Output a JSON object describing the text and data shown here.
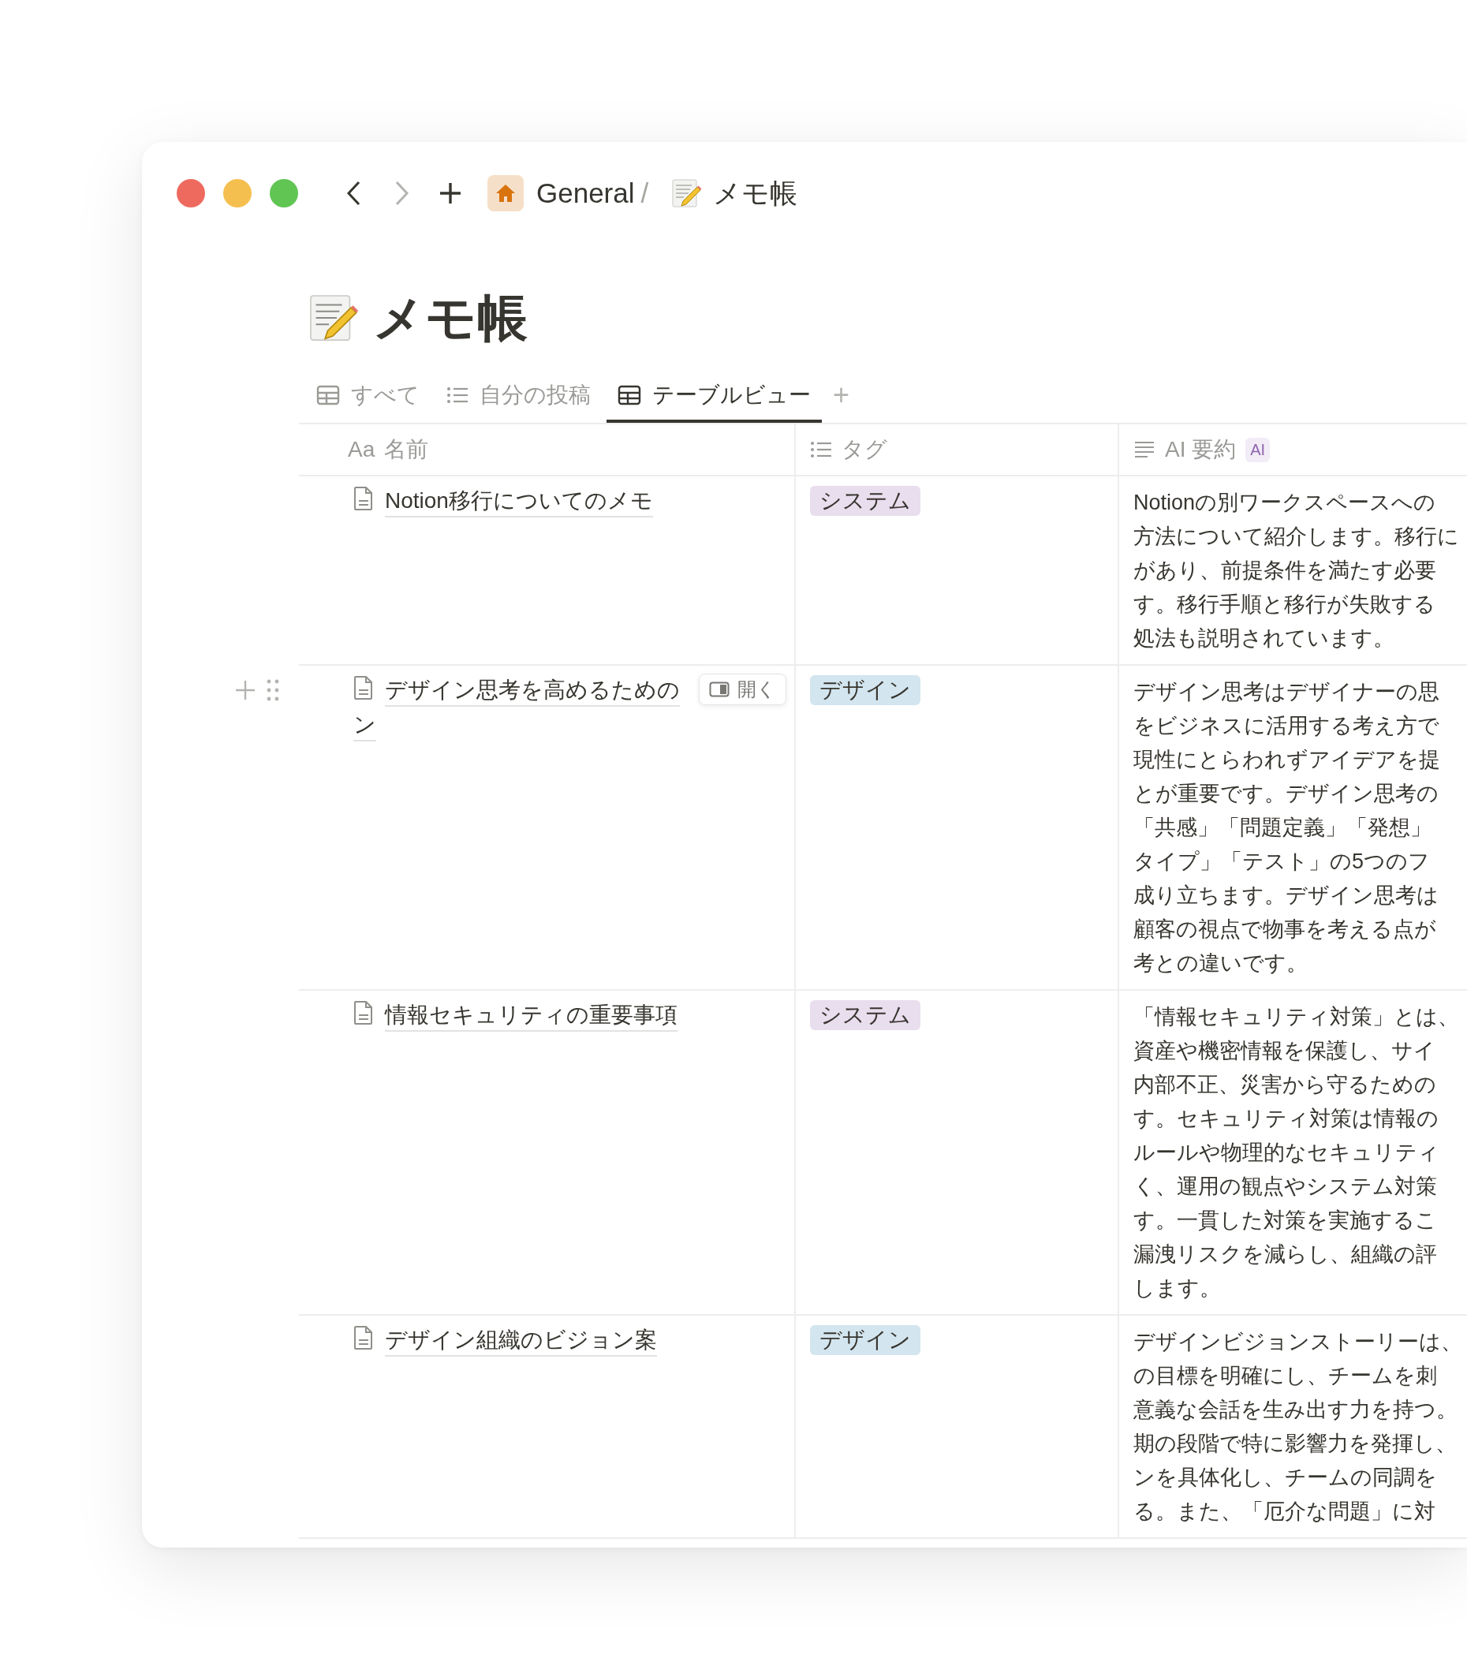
{
  "window": {
    "traffic_lights": [
      {
        "color": "#ee6a5f"
      },
      {
        "color": "#f5bf4f"
      },
      {
        "color": "#61c554"
      }
    ]
  },
  "toolbar": {
    "breadcrumbs": [
      {
        "label": "General",
        "kind": "home",
        "separator": "/"
      },
      {
        "label": "メモ帳",
        "kind": "memo"
      }
    ]
  },
  "page": {
    "title": "メモ帳"
  },
  "tabs": [
    {
      "label": "すべて",
      "kind": "table",
      "selected": false
    },
    {
      "label": "自分の投稿",
      "kind": "list",
      "selected": false
    },
    {
      "label": "テーブルビュー",
      "kind": "table",
      "selected": true
    }
  ],
  "add_tab": "+",
  "table": {
    "columns": [
      {
        "label": "名前",
        "kind": "title",
        "icon_text": "Aa"
      },
      {
        "label": "タグ",
        "kind": "multi"
      },
      {
        "label": "AI 要約",
        "kind": "ai",
        "badge": "AI"
      }
    ],
    "open_label": "開く",
    "rows": [
      {
        "hovered": false,
        "name_lines": [
          "Notion移行についてのメモ"
        ],
        "tag": {
          "label": "システム",
          "color": "#e8deee"
        },
        "summary_lines": [
          "Notionの別ワークスペースへの",
          "方法について紹介します。移行に",
          "があり、前提条件を満たす必要",
          "す。移行手順と移行が失敗する",
          "処法も説明されています。"
        ]
      },
      {
        "hovered": true,
        "name_lines": [
          "デザイン思考を高めるための",
          "ン"
        ],
        "tag": {
          "label": "デザイン",
          "color": "#d3e5ef"
        },
        "summary_lines": [
          "デザイン思考はデザイナーの思",
          "をビジネスに活用する考え方で",
          "現性にとらわれずアイデアを提",
          "とが重要です。デザイン思考の",
          "「共感」「問題定義」「発想」",
          "タイプ」「テスト」の5つのフ",
          "成り立ちます。デザイン思考は",
          "顧客の視点で物事を考える点が",
          "考との違いです。"
        ]
      },
      {
        "hovered": false,
        "name_lines": [
          "情報セキュリティの重要事項"
        ],
        "tag": {
          "label": "システム",
          "color": "#e8deee"
        },
        "summary_lines": [
          "「情報セキュリティ対策」とは、",
          "資産や機密情報を保護し、サイ",
          "内部不正、災害から守るための",
          "す。セキュリティ対策は情報の",
          "ルールや物理的なセキュリティ",
          "く、運用の観点やシステム対策",
          "す。一貫した対策を実施するこ",
          "漏洩リスクを減らし、組織の評",
          "します。"
        ]
      },
      {
        "hovered": false,
        "name_lines": [
          "デザイン組織のビジョン案"
        ],
        "tag": {
          "label": "デザイン",
          "color": "#d3e5ef"
        },
        "summary_lines": [
          "デザインビジョンストーリーは、",
          "の目標を明確にし、チームを刺",
          "意義な会話を生み出す力を持つ。",
          "期の段階で特に影響力を発揮し、",
          "ンを具体化し、チームの同調を",
          "る。また、「厄介な問題」に対"
        ]
      }
    ]
  }
}
